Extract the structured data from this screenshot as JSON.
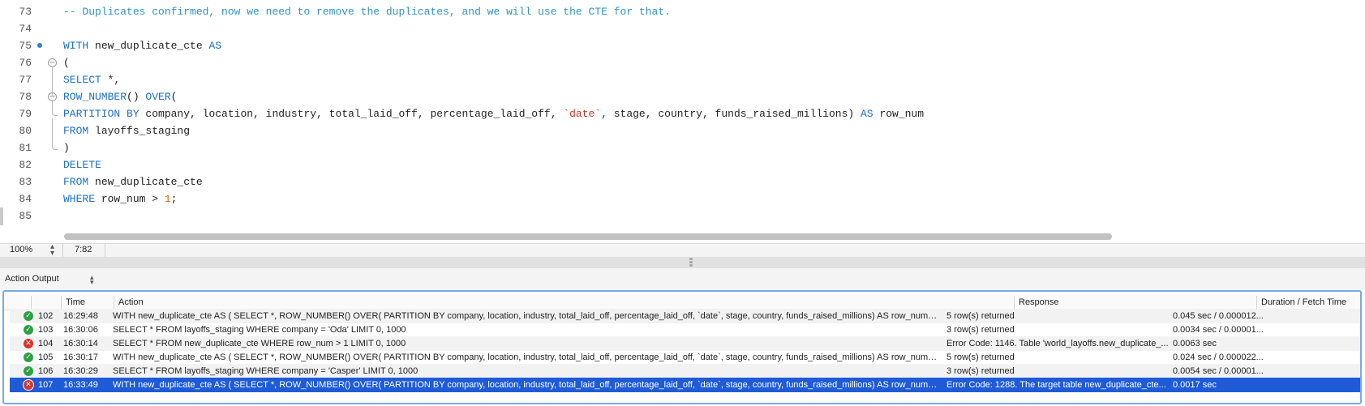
{
  "editor": {
    "lines": [
      {
        "num": "73",
        "tokens": [
          {
            "t": "-- Duplicates confirmed, now we need to remove the duplicates, and we will use the CTE for that.",
            "c": "cm"
          }
        ]
      },
      {
        "num": "74",
        "tokens": []
      },
      {
        "num": "75",
        "tokens": [
          {
            "t": "WITH",
            "c": "kw"
          },
          {
            "t": " new_duplicate_cte ",
            "c": ""
          },
          {
            "t": "AS",
            "c": "kw"
          }
        ]
      },
      {
        "num": "76",
        "tokens": [
          {
            "t": "(",
            "c": ""
          }
        ]
      },
      {
        "num": "77",
        "tokens": [
          {
            "t": "SELECT",
            "c": "kw"
          },
          {
            "t": " *,",
            "c": ""
          }
        ]
      },
      {
        "num": "78",
        "tokens": [
          {
            "t": "ROW_NUMBER",
            "c": "kw"
          },
          {
            "t": "() ",
            "c": ""
          },
          {
            "t": "OVER",
            "c": "kw"
          },
          {
            "t": "(",
            "c": ""
          }
        ]
      },
      {
        "num": "79",
        "tokens": [
          {
            "t": "PARTITION BY",
            "c": "kw"
          },
          {
            "t": " company, location, industry, total_laid_off, percentage_laid_off, ",
            "c": ""
          },
          {
            "t": "`date`",
            "c": "str"
          },
          {
            "t": ", stage, country, funds_raised_millions) ",
            "c": ""
          },
          {
            "t": "AS",
            "c": "kw"
          },
          {
            "t": " row_num",
            "c": ""
          }
        ]
      },
      {
        "num": "80",
        "tokens": [
          {
            "t": "FROM",
            "c": "kw"
          },
          {
            "t": " layoffs_staging",
            "c": ""
          }
        ]
      },
      {
        "num": "81",
        "tokens": [
          {
            "t": ")",
            "c": ""
          }
        ]
      },
      {
        "num": "82",
        "tokens": [
          {
            "t": "DELETE",
            "c": "kw"
          }
        ]
      },
      {
        "num": "83",
        "tokens": [
          {
            "t": "FROM",
            "c": "kw"
          },
          {
            "t": " new_duplicate_cte",
            "c": ""
          }
        ]
      },
      {
        "num": "84",
        "tokens": [
          {
            "t": "WHERE",
            "c": "kw"
          },
          {
            "t": " row_num > ",
            "c": ""
          },
          {
            "t": "1",
            "c": "num"
          },
          {
            "t": ";",
            "c": ""
          }
        ]
      },
      {
        "num": "85",
        "tokens": []
      }
    ]
  },
  "status": {
    "zoom": "100%",
    "cursor": "7:82"
  },
  "output": {
    "title": "Action Output",
    "columns": [
      "",
      "",
      "Time",
      "Action",
      "Response",
      "Duration / Fetch Time"
    ],
    "rows": [
      {
        "status": "ok",
        "num": "102",
        "time": "16:29:48",
        "action": "WITH new_duplicate_cte AS ( SELECT *, ROW_NUMBER() OVER( PARTITION BY company, location, industry, total_laid_off, percentage_laid_off, `date`, stage, country, funds_raised_millions) AS row_num FR...",
        "response": "5 row(s) returned",
        "duration": "0.045 sec / 0.000012..."
      },
      {
        "status": "ok",
        "num": "103",
        "time": "16:30:06",
        "action": "SELECT * FROM layoffs_staging WHERE company  = 'Oda' LIMIT 0, 1000",
        "response": "3 row(s) returned",
        "duration": "0.0034 sec / 0.00001..."
      },
      {
        "status": "err",
        "num": "104",
        "time": "16:30:14",
        "action": "SELECT * FROM new_duplicate_cte WHERE row_num > 1 LIMIT 0, 1000",
        "response": "Error Code: 1146. Table 'world_layoffs.new_duplicate_...",
        "duration": "0.0063 sec"
      },
      {
        "status": "ok",
        "num": "105",
        "time": "16:30:17",
        "action": "WITH new_duplicate_cte AS ( SELECT *, ROW_NUMBER() OVER( PARTITION BY company, location, industry, total_laid_off, percentage_laid_off, `date`, stage, country, funds_raised_millions) AS row_num FR...",
        "response": "5 row(s) returned",
        "duration": "0.024 sec / 0.000022..."
      },
      {
        "status": "ok",
        "num": "106",
        "time": "16:30:29",
        "action": "SELECT * FROM layoffs_staging WHERE company  = 'Casper' LIMIT 0, 1000",
        "response": "3 row(s) returned",
        "duration": "0.0054 sec / 0.00001..."
      },
      {
        "status": "err",
        "num": "107",
        "time": "16:33:49",
        "action": "WITH new_duplicate_cte AS ( SELECT *, ROW_NUMBER() OVER( PARTITION BY company, location, industry, total_laid_off, percentage_laid_off, `date`, stage, country, funds_raised_millions) AS row_num FR...",
        "response": "Error Code: 1288. The target table new_duplicate_cte...",
        "duration": "0.0017 sec",
        "selected": true
      }
    ]
  },
  "icons": {
    "ok": "check-circle-icon",
    "err": "error-x-circle-icon"
  },
  "colors": {
    "keyword": "#1a6fc4",
    "comment": "#2f93c6",
    "string": "#c3372b",
    "number": "#d2691e",
    "ok": "#2ea043",
    "error": "#d9342b",
    "selection": "#1f5bd6"
  }
}
